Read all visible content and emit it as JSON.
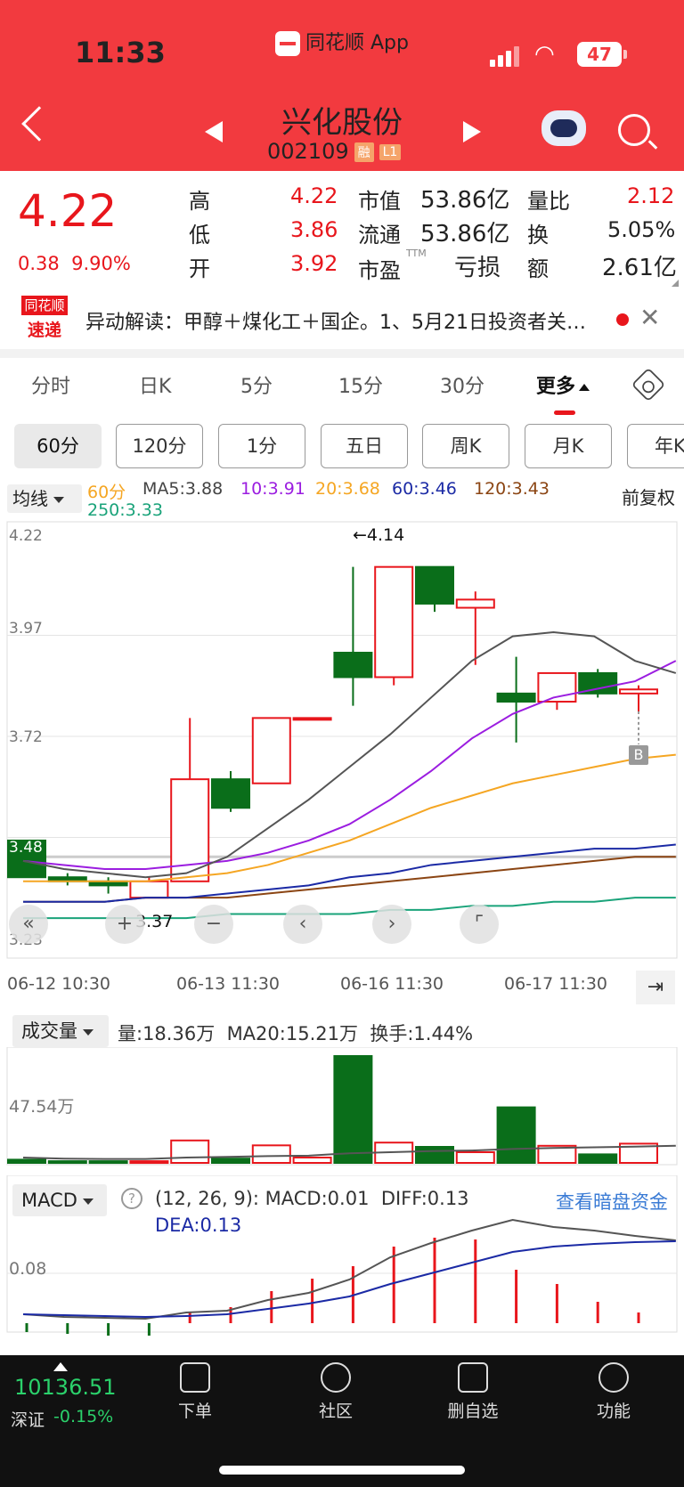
{
  "status": {
    "time": "11:33",
    "app": "同花顺 App",
    "battery": "47"
  },
  "header": {
    "name": "兴化股份",
    "code": "002109",
    "tags": [
      "融",
      "L1"
    ]
  },
  "quote": {
    "price": "4.22",
    "change": "0.38",
    "pct": "9.90%",
    "stats": [
      {
        "label": "高",
        "value": "4.22"
      },
      {
        "label": "低",
        "value": "3.86"
      },
      {
        "label": "开",
        "value": "3.92"
      },
      {
        "label": "市值",
        "value": "53.86亿"
      },
      {
        "label": "流通",
        "value": "53.86亿"
      },
      {
        "label": "市盈",
        "value": "亏损",
        "sup": "TTM"
      },
      {
        "label": "量比",
        "value": "2.12"
      },
      {
        "label": "换",
        "value": "5.05%"
      },
      {
        "label": "额",
        "value": "2.61亿"
      }
    ]
  },
  "news": {
    "logo_top": "同花顺",
    "logo_bottom": "速递",
    "text": "异动解读：甲醇＋煤化工＋国企。1、5月21日投资者关…"
  },
  "tabs": [
    "分时",
    "日K",
    "5分",
    "15分",
    "30分",
    "更多"
  ],
  "periods": [
    "60分",
    "120分",
    "1分",
    "五日",
    "周K",
    "月K",
    "年K"
  ],
  "indicators": {
    "select": "均线",
    "items": [
      "60分",
      "MA5:3.88",
      "10:3.91",
      "20:3.68",
      "60:3.46",
      "120:3.43",
      "250:3.33"
    ],
    "adjust": "前复权"
  },
  "colors": {
    "up": "#e8161c",
    "down": "#0a6e1a",
    "ma5": "#555555",
    "ma10": "#9b1de0",
    "ma20": "#f5a623",
    "ma60": "#1b2aa5",
    "ma120": "#8b4513",
    "ma250": "#1aa37a",
    "header": "#f23a3f"
  },
  "chart_data": [
    {
      "type": "candlestick",
      "ylim": [
        3.23,
        4.22
      ],
      "y_ticks": [
        "4.22",
        "3.97",
        "3.72",
        "3.48",
        "3.23"
      ],
      "x_labels": [
        "06-12 10:30",
        "06-13 11:30",
        "06-16 11:30",
        "06-17 11:30"
      ],
      "high_label": "←4.14",
      "low_label": "3.37",
      "marker": "B",
      "candles": [
        {
          "o": 3.47,
          "h": 3.47,
          "l": 3.38,
          "c": 3.38
        },
        {
          "o": 3.38,
          "h": 3.39,
          "l": 3.36,
          "c": 3.37
        },
        {
          "o": 3.37,
          "h": 3.38,
          "l": 3.34,
          "c": 3.36
        },
        {
          "o": 3.33,
          "h": 3.38,
          "l": 3.33,
          "c": 3.37
        },
        {
          "o": 3.37,
          "h": 3.77,
          "l": 3.37,
          "c": 3.62
        },
        {
          "o": 3.62,
          "h": 3.64,
          "l": 3.54,
          "c": 3.55
        },
        {
          "o": 3.61,
          "h": 3.77,
          "l": 3.61,
          "c": 3.77
        },
        {
          "o": 3.77,
          "h": 3.77,
          "l": 3.77,
          "c": 3.77
        },
        {
          "o": 3.93,
          "h": 4.14,
          "l": 3.8,
          "c": 3.87
        },
        {
          "o": 3.87,
          "h": 4.14,
          "l": 3.85,
          "c": 4.14
        },
        {
          "o": 4.14,
          "h": 4.14,
          "l": 4.03,
          "c": 4.05
        },
        {
          "o": 4.04,
          "h": 4.08,
          "l": 3.9,
          "c": 4.06
        },
        {
          "o": 3.83,
          "h": 3.92,
          "l": 3.71,
          "c": 3.81
        },
        {
          "o": 3.81,
          "h": 3.88,
          "l": 3.79,
          "c": 3.88
        },
        {
          "o": 3.88,
          "h": 3.89,
          "l": 3.82,
          "c": 3.83
        },
        {
          "o": 3.83,
          "h": 3.85,
          "l": 3.78,
          "c": 3.84
        }
      ],
      "ma5": [
        3.42,
        3.4,
        3.39,
        3.38,
        3.39,
        3.43,
        3.5,
        3.57,
        3.65,
        3.73,
        3.82,
        3.91,
        3.97,
        3.98,
        3.97,
        3.91,
        3.88
      ],
      "ma10": [
        3.42,
        3.41,
        3.4,
        3.4,
        3.41,
        3.42,
        3.44,
        3.47,
        3.51,
        3.57,
        3.64,
        3.72,
        3.78,
        3.82,
        3.84,
        3.86,
        3.91
      ],
      "ma20": [
        3.37,
        3.37,
        3.37,
        3.37,
        3.38,
        3.39,
        3.41,
        3.44,
        3.47,
        3.51,
        3.55,
        3.58,
        3.61,
        3.63,
        3.65,
        3.67,
        3.68
      ],
      "ma60": [
        3.32,
        3.32,
        3.32,
        3.33,
        3.33,
        3.34,
        3.35,
        3.36,
        3.38,
        3.39,
        3.41,
        3.42,
        3.43,
        3.44,
        3.45,
        3.45,
        3.46
      ],
      "ma120": [
        3.32,
        3.32,
        3.32,
        3.33,
        3.33,
        3.33,
        3.34,
        3.35,
        3.36,
        3.37,
        3.38,
        3.39,
        3.4,
        3.41,
        3.42,
        3.43,
        3.43
      ],
      "ma250": [
        3.28,
        3.28,
        3.28,
        3.28,
        3.28,
        3.29,
        3.29,
        3.29,
        3.29,
        3.3,
        3.3,
        3.31,
        3.31,
        3.32,
        3.32,
        3.33,
        3.33
      ]
    },
    {
      "type": "bar",
      "title": "成交量",
      "info": [
        "量:18.36万",
        "MA20:15.21万",
        "换手:1.44%"
      ],
      "y_tick": "47.54万",
      "values": [
        1.5,
        0.8,
        0.8,
        0.8,
        10.5,
        2.0,
        8.2,
        2.5,
        50.0,
        9.5,
        7.5,
        5.0,
        26.0,
        8.0,
        4.0,
        9.0
      ],
      "ma": [
        2.5,
        2.0,
        1.8,
        1.8,
        2.5,
        2.8,
        3.2,
        3.4,
        4.5,
        5.0,
        5.5,
        5.8,
        6.5,
        7.0,
        7.3,
        7.6,
        8.0
      ]
    },
    {
      "type": "macd",
      "title": "MACD",
      "params": "(12, 26, 9):",
      "info": [
        "MACD:0.01",
        "DIFF:0.13"
      ],
      "dea_label": "DEA:0.13",
      "y_tick": "0.08",
      "link": "查看暗盘资金",
      "macd": [
        -0.005,
        -0.006,
        -0.008,
        -0.009,
        0.006,
        0.009,
        0.018,
        0.025,
        0.032,
        0.043,
        0.048,
        0.047,
        0.03,
        0.022,
        0.012,
        0.006
      ],
      "diff": [
        0.0,
        -0.003,
        -0.004,
        -0.005,
        0.002,
        0.004,
        0.016,
        0.024,
        0.039,
        0.064,
        0.08,
        0.094,
        0.106,
        0.098,
        0.094,
        0.088,
        0.083
      ],
      "dea": [
        0.0,
        -0.001,
        -0.002,
        -0.003,
        -0.002,
        0.0,
        0.006,
        0.012,
        0.02,
        0.034,
        0.046,
        0.058,
        0.07,
        0.076,
        0.079,
        0.081,
        0.082
      ]
    }
  ],
  "bottom": {
    "index_value": "10136.51",
    "index_name": "深证",
    "index_change": "-0.15%",
    "nav": [
      {
        "label": "下单",
        "icon": "order-icon"
      },
      {
        "label": "社区",
        "icon": "community-icon"
      },
      {
        "label": "删自选",
        "icon": "remove-watchlist-icon"
      },
      {
        "label": "功能",
        "icon": "menu-icon"
      }
    ]
  }
}
